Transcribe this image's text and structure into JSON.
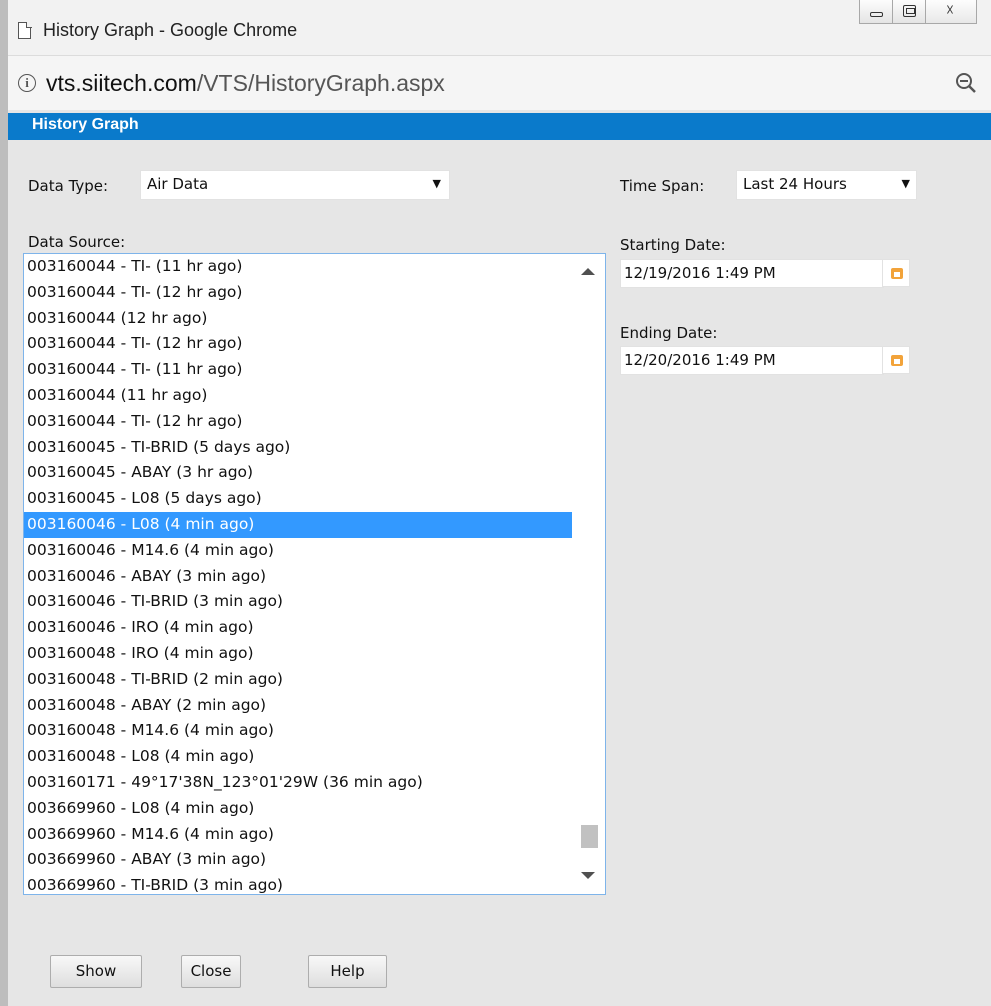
{
  "window": {
    "title": "History Graph - Google Chrome",
    "url_host": "vts.siitech.com",
    "url_path": "/VTS/HistoryGraph.aspx",
    "close_glyph": "☓"
  },
  "header": {
    "title": "History Graph"
  },
  "form": {
    "data_type_label": "Data Type:",
    "data_type_value": "Air Data",
    "time_span_label": "Time Span:",
    "time_span_value": "Last 24 Hours",
    "data_source_label": "Data Source:",
    "starting_date_label": "Starting Date:",
    "starting_date_value": "12/19/2016 1:49 PM",
    "ending_date_label": "Ending Date:",
    "ending_date_value": "12/20/2016 1:49 PM"
  },
  "data_source": {
    "selected_index": 10,
    "items": [
      "003160044 - TI- (11 hr ago)",
      "003160044 - TI- (12 hr ago)",
      "003160044 (12 hr ago)",
      "003160044 - TI- (12 hr ago)",
      "003160044 - TI- (11 hr ago)",
      "003160044 (11 hr ago)",
      "003160044 - TI- (12 hr ago)",
      "003160045 - TI-BRID (5 days ago)",
      "003160045 - ABAY (3 hr ago)",
      "003160045 - L08 (5 days ago)",
      "003160046 - L08 (4 min ago)",
      "003160046 - M14.6 (4 min ago)",
      "003160046 - ABAY (3 min ago)",
      "003160046 - TI-BRID (3 min ago)",
      "003160046 - IRO (4 min ago)",
      "003160048 - IRO (4 min ago)",
      "003160048 - TI-BRID (2 min ago)",
      "003160048 - ABAY (2 min ago)",
      "003160048 - M14.6 (4 min ago)",
      "003160048 - L08 (4 min ago)",
      "003160171 - 49°17'38N_123°01'29W (36 min ago)",
      "003669960 - L08 (4 min ago)",
      "003669960 - M14.6 (4 min ago)",
      "003669960 - ABAY (3 min ago)",
      "003669960 - TI-BRID (3 min ago)"
    ]
  },
  "buttons": {
    "show": "Show",
    "close": "Close",
    "help": "Help"
  },
  "colors": {
    "header_bg": "#0a7acb",
    "selection_bg": "#3399ff",
    "calendar_icon": "#f2a33a"
  }
}
